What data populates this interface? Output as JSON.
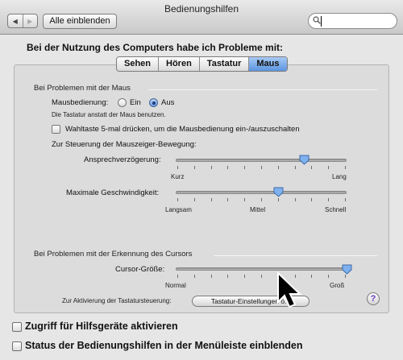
{
  "window": {
    "title": "Bedienungshilfen"
  },
  "toolbar": {
    "back_icon": "back-arrow-icon",
    "forward_icon": "forward-arrow-icon",
    "show_all_label": "Alle einblenden",
    "search_value": ""
  },
  "content": {
    "heading": "Bei der Nutzung des Computers habe ich Probleme mit:",
    "tabs": [
      {
        "label": "Sehen",
        "active": false
      },
      {
        "label": "Hören",
        "active": false
      },
      {
        "label": "Tastatur",
        "active": false
      },
      {
        "label": "Maus",
        "active": true
      }
    ],
    "mouse_group": {
      "title": "Bei Problemen mit der Maus",
      "mausbedienung_label": "Mausbedienung:",
      "option_on": "Ein",
      "option_off": "Aus",
      "selected": "Aus",
      "hint": "Die Tastatur anstatt der Maus benutzen.",
      "option_key_label": "Wahltaste 5-mal drücken, um die Mausbedienung ein-/auszuschalten",
      "option_key_checked": false,
      "pointer_section_label": "Zur Steuerung der Mauszeiger-Bewegung:",
      "delay": {
        "label": "Ansprechverzögerung:",
        "min_label": "Kurz",
        "max_label": "Lang",
        "value_fraction": 0.75
      },
      "speed": {
        "label": "Maximale Geschwindigkeit:",
        "min_label": "Langsam",
        "mid_label": "Mittel",
        "max_label": "Schnell",
        "value_fraction": 0.6
      }
    },
    "cursor_group": {
      "title": "Bei Problemen mit der Erkennung des Cursors",
      "size": {
        "label": "Cursor-Größe:",
        "min_label": "Normal",
        "max_label": "Groß",
        "value_fraction": 1.0
      },
      "keyboard_note": "Zur Aktivierung der Tastatursteuerung:",
      "keyboard_button": "Tastatur-Einstellungen ö..."
    },
    "help_label": "?"
  },
  "footer": {
    "assistive_label": "Zugriff für Hilfsgeräte aktivieren",
    "assistive_checked": false,
    "menubar_label": "Status der Bedienungshilfen in der Menüleiste einblenden",
    "menubar_checked": false
  }
}
